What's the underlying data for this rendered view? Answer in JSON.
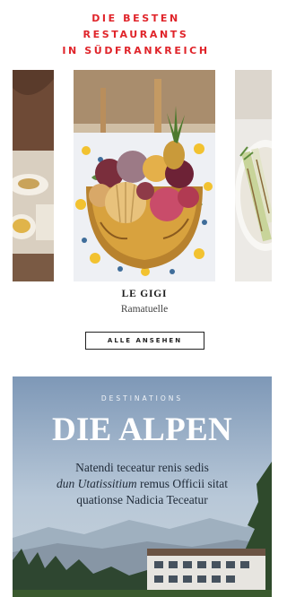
{
  "headline": {
    "line1": "DIE BESTEN",
    "line2": "RESTAURANTS",
    "line3": "IN SÜDFRANKREICH",
    "color": "#e0242a"
  },
  "carousel": {
    "slides": [
      {
        "kind": "partial-left",
        "image": "restaurant-table-photo"
      },
      {
        "kind": "active",
        "image": "figs-in-yellow-bowl-photo"
      },
      {
        "kind": "partial-right",
        "image": "grilled-fennel-plate-photo"
      }
    ],
    "active": {
      "title": "LE GIGI",
      "location": "Ramatuelle"
    },
    "see_all_label": "ALLE ANSEHEN"
  },
  "destination": {
    "eyebrow": "DESTINATIONS",
    "title": "DIE ALPEN",
    "text_line1": "Natendi teceatur renis sedis",
    "text_line2_italic": "dun Utatissitium",
    "text_line2_rest": " remus Officii sitat",
    "text_line3": "quationse Nadicia Teceatur",
    "image": "alpine-lake-hotel-photo"
  }
}
